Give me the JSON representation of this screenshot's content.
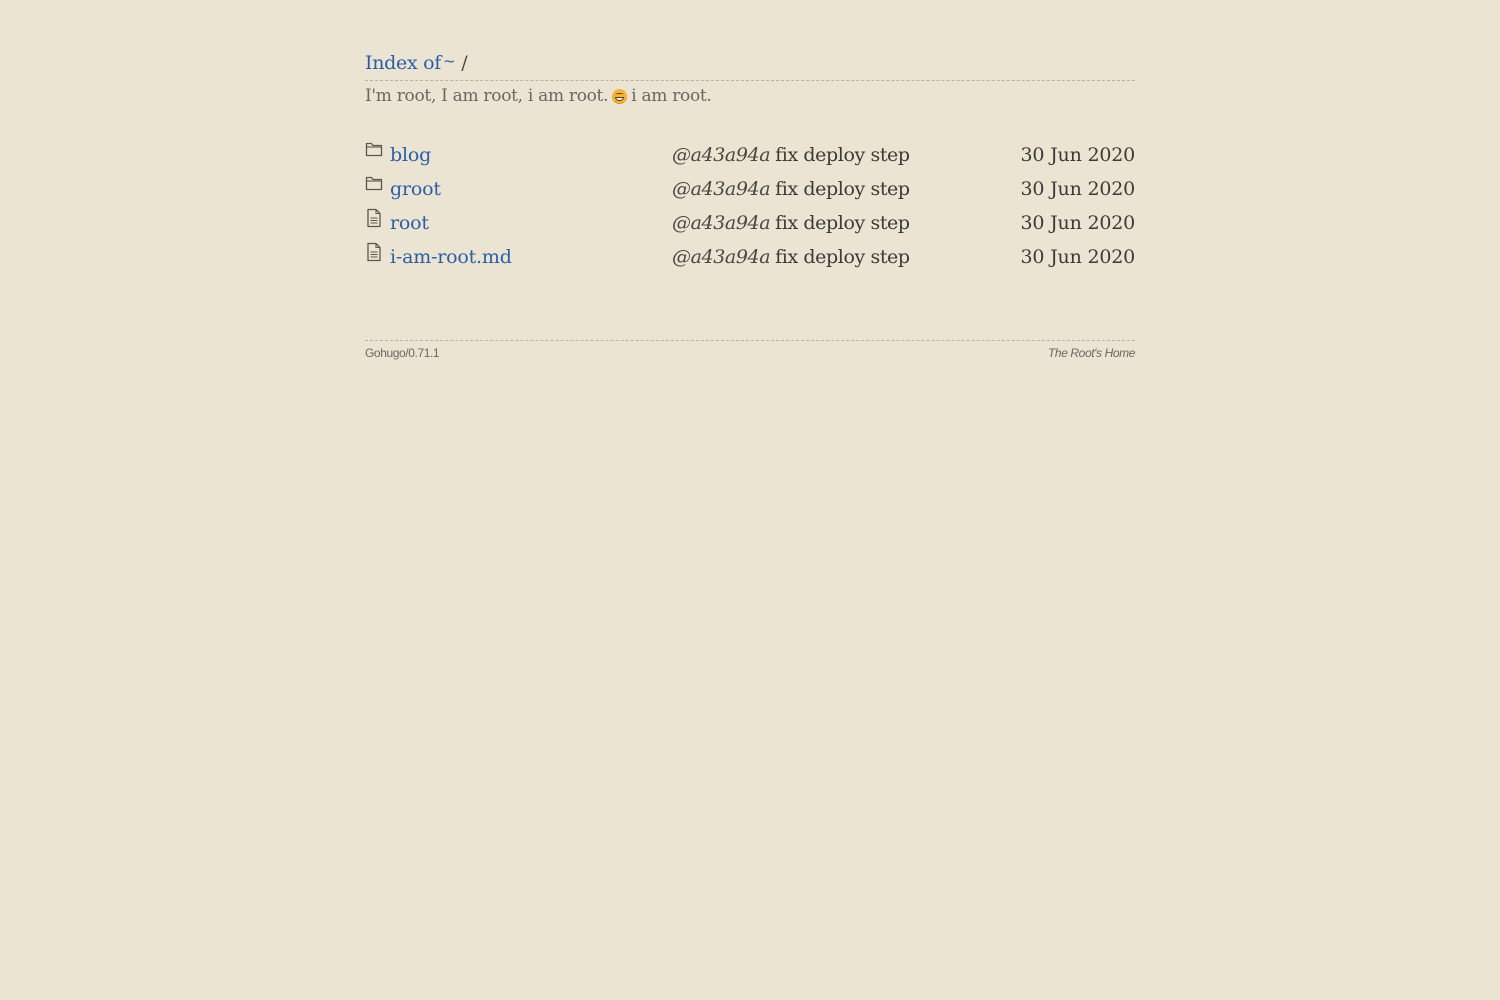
{
  "header": {
    "index_label": "Index of",
    "home_symbol": "~",
    "path_separator": "/"
  },
  "subtitle": {
    "text_before": "I'm root, I am root, i am root.",
    "emoji_icon": "grinning-face-icon",
    "text_after": "i am root."
  },
  "entries": [
    {
      "type": "folder",
      "icon": "folder-icon",
      "name": "blog",
      "hash": "@a43a94a",
      "message": "fix deploy step",
      "date": "30 Jun 2020"
    },
    {
      "type": "folder",
      "icon": "folder-icon",
      "name": "groot",
      "hash": "@a43a94a",
      "message": "fix deploy step",
      "date": "30 Jun 2020"
    },
    {
      "type": "file",
      "icon": "file-icon",
      "name": "root",
      "hash": "@a43a94a",
      "message": "fix deploy step",
      "date": "30 Jun 2020"
    },
    {
      "type": "file",
      "icon": "file-icon",
      "name": "i-am-root.md",
      "hash": "@a43a94a",
      "message": "fix deploy step",
      "date": "30 Jun 2020"
    }
  ],
  "footer": {
    "generator": "Gohugo/0.71.1",
    "site_name": "The Root's Home"
  },
  "colors": {
    "background": "#ebe4d2",
    "link": "#2b5ea7",
    "text": "#3c3a36",
    "muted": "#6b6760"
  }
}
